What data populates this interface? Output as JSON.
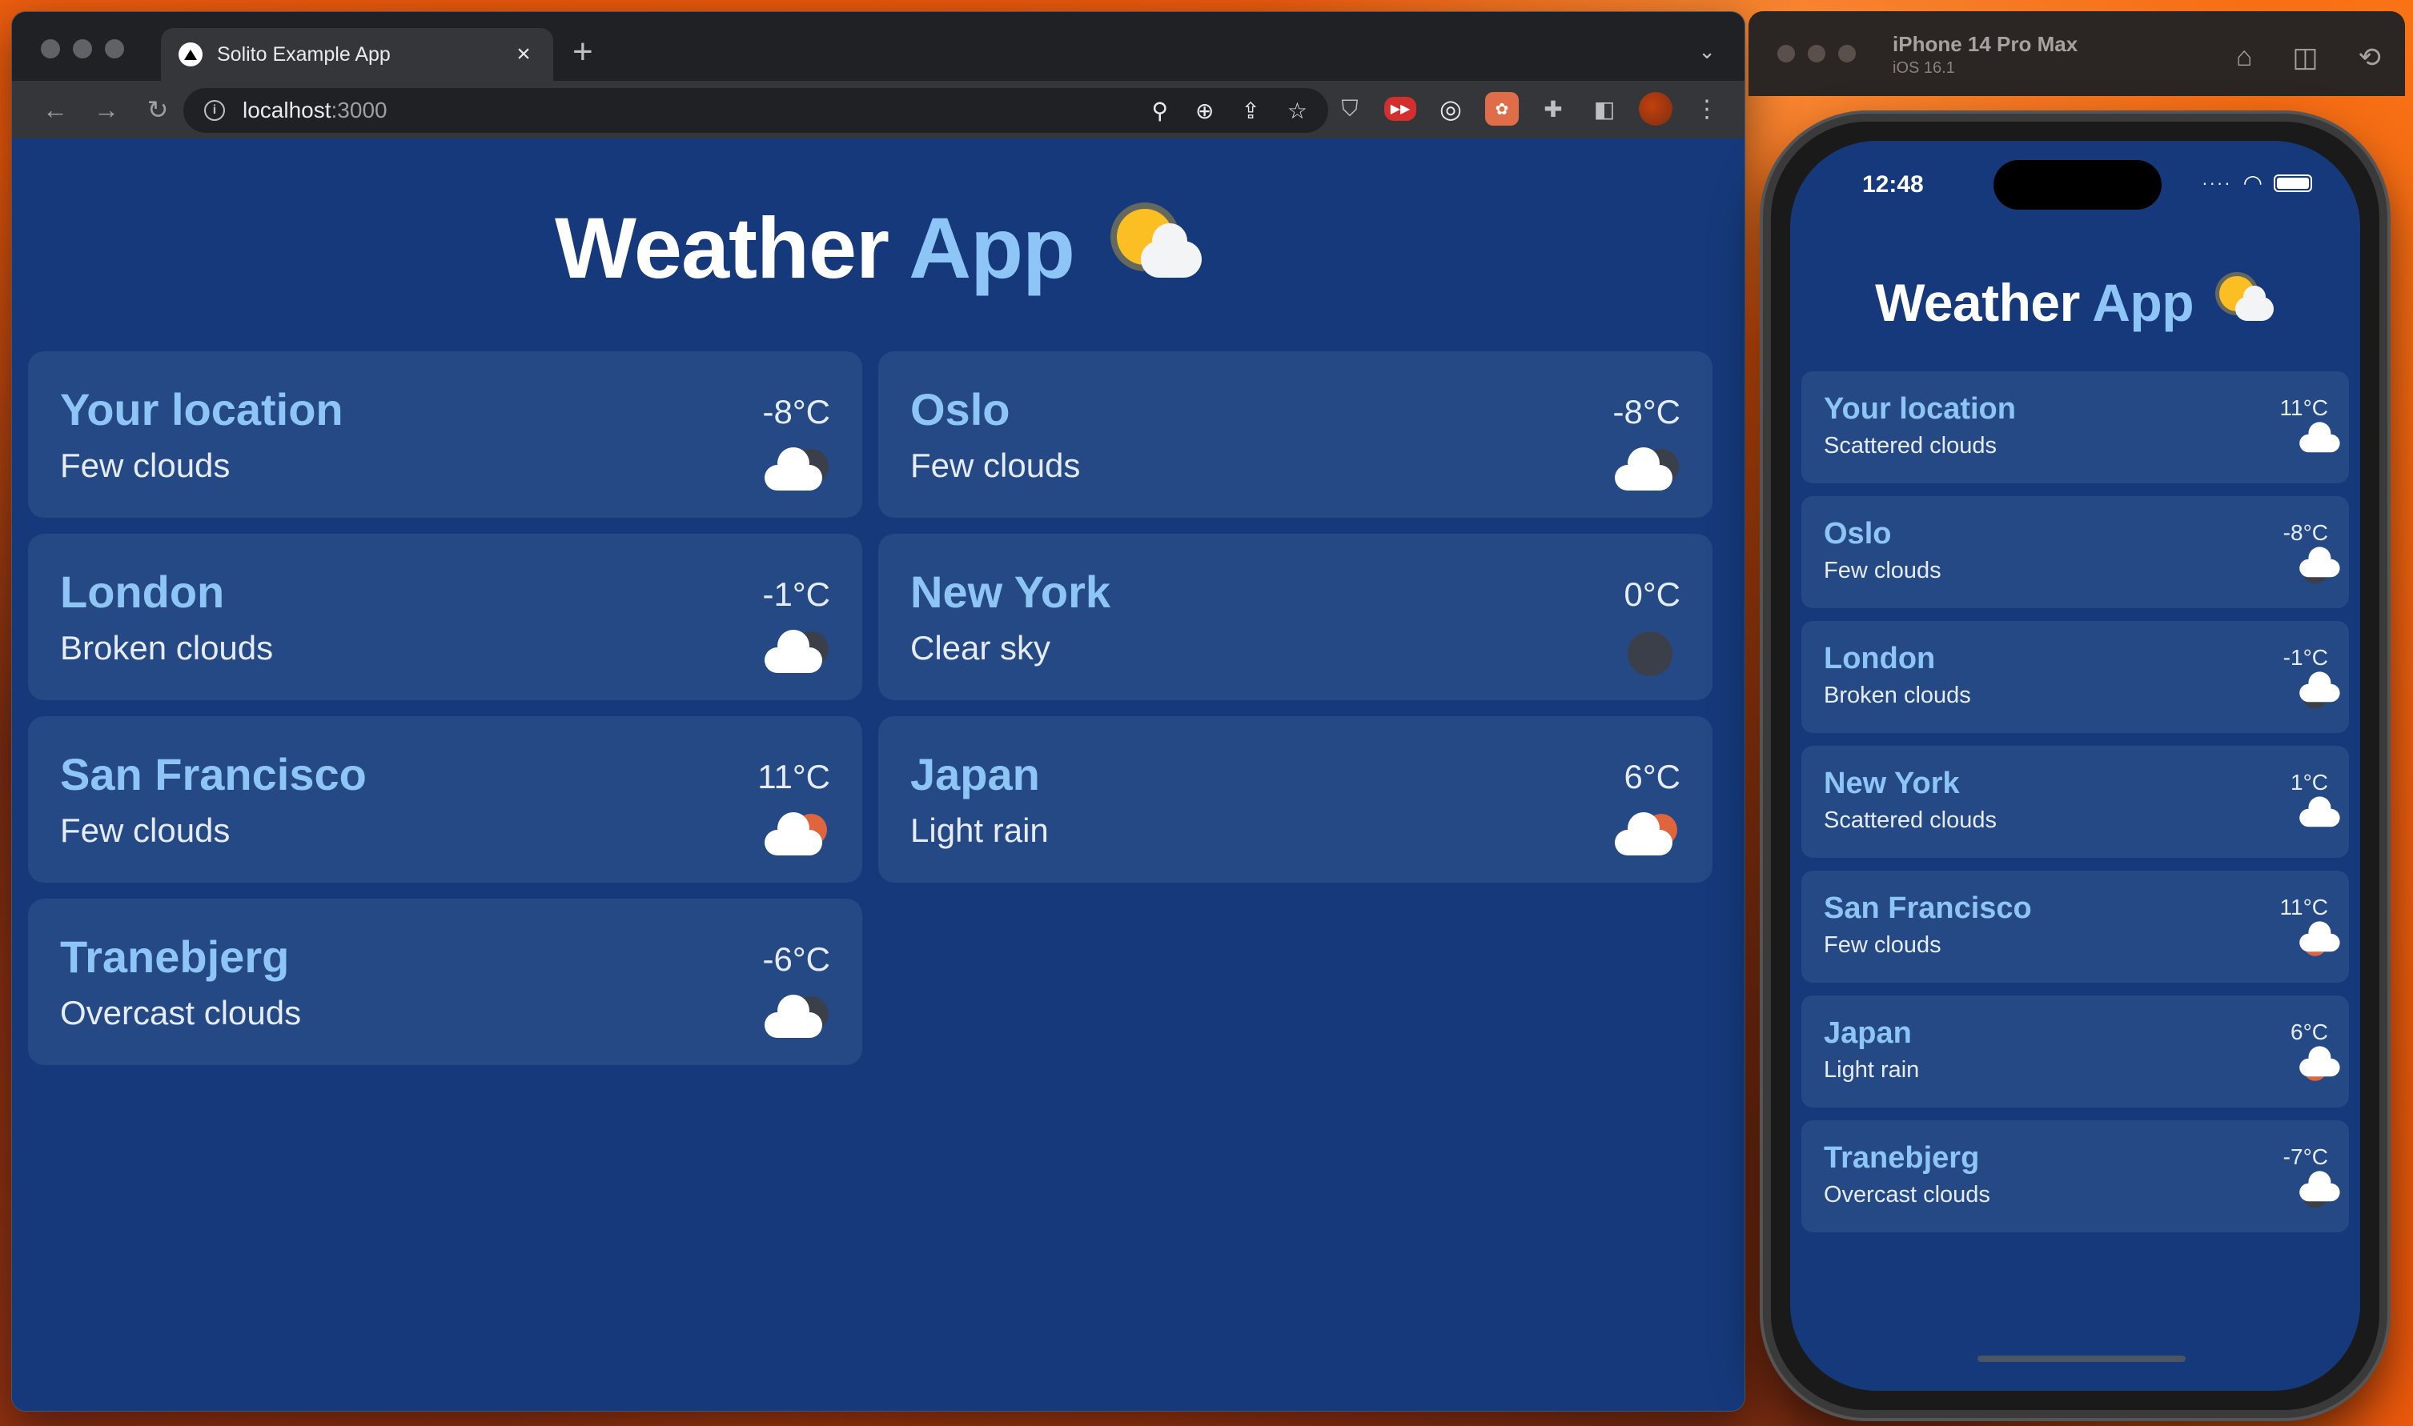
{
  "browser": {
    "tab_title": "Solito Example App",
    "tab_close": "×",
    "new_tab": "+",
    "url_host": "localhost",
    "url_port": ":3000",
    "nav": {
      "back": "←",
      "forward": "→",
      "reload": "↻"
    }
  },
  "web": {
    "title_main": "Weather",
    "title_accent": "App",
    "cards": [
      {
        "city": "Your location",
        "desc": "Few clouds",
        "temp": "-8°C",
        "icon": "cloud-night-icon"
      },
      {
        "city": "Oslo",
        "desc": "Few clouds",
        "temp": "-8°C",
        "icon": "cloud-night-icon"
      },
      {
        "city": "London",
        "desc": "Broken clouds",
        "temp": "-1°C",
        "icon": "cloud-night-icon"
      },
      {
        "city": "New York",
        "desc": "Clear sky",
        "temp": "0°C",
        "icon": "moon-icon"
      },
      {
        "city": "San Francisco",
        "desc": "Few clouds",
        "temp": "11°C",
        "icon": "cloud-sun-icon"
      },
      {
        "city": "Japan",
        "desc": "Light rain",
        "temp": "6°C",
        "icon": "rain-sun-icon"
      },
      {
        "city": "Tranebjerg",
        "desc": "Overcast clouds",
        "temp": "-6°C",
        "icon": "cloud-night-icon"
      }
    ]
  },
  "simulator": {
    "device": "iPhone 14 Pro Max",
    "os": "iOS 16.1",
    "time": "12:48"
  },
  "mobile": {
    "title_main": "Weather",
    "title_accent": "App",
    "cards": [
      {
        "city": "Your location",
        "desc": "Scattered clouds",
        "temp": "11°C",
        "icon": "cloud-icon"
      },
      {
        "city": "Oslo",
        "desc": "Few clouds",
        "temp": "-8°C",
        "icon": "cloud-night-icon"
      },
      {
        "city": "London",
        "desc": "Broken clouds",
        "temp": "-1°C",
        "icon": "cloud-night-icon"
      },
      {
        "city": "New York",
        "desc": "Scattered clouds",
        "temp": "1°C",
        "icon": "cloud-icon"
      },
      {
        "city": "San Francisco",
        "desc": "Few clouds",
        "temp": "11°C",
        "icon": "cloud-sun-icon"
      },
      {
        "city": "Japan",
        "desc": "Light rain",
        "temp": "6°C",
        "icon": "rain-sun-icon"
      },
      {
        "city": "Tranebjerg",
        "desc": "Overcast clouds",
        "temp": "-7°C",
        "icon": "cloud-night-icon"
      }
    ]
  },
  "colors": {
    "page_bg": "#15397a",
    "card_bg": "#244984",
    "accent": "#8ec5f7"
  }
}
